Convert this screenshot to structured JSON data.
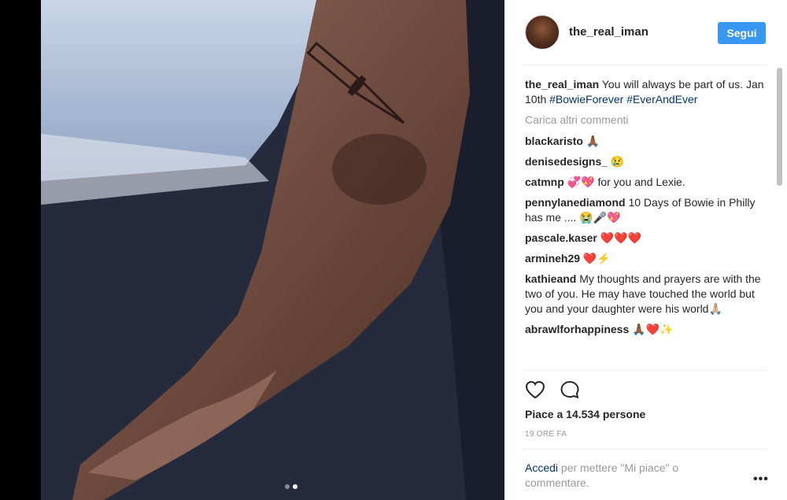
{
  "post": {
    "username": "the_real_iman",
    "follow_label": "Segui",
    "caption_text": " You will always be part of us. Jan 10th ",
    "hashtag1": "#BowieForever",
    "hashtag2": "#EverAndEver",
    "load_more": "Carica altri commenti",
    "likes": "Piace a 14.534 persone",
    "time": "19 ORE FA",
    "login_link": "Accedi",
    "login_text": " per mettere \"Mi piace\" o commentare.",
    "more_label": "•••"
  },
  "comments": [
    {
      "user": "blackaristo",
      "text": " 🙏🏾"
    },
    {
      "user": "denisedesigns_",
      "text": " 😢"
    },
    {
      "user": "catmnp",
      "text": " 💞💖 for you and Lexie."
    },
    {
      "user": "pennylanediamond",
      "text": " 10 Days of Bowie in Philly has me .... 😭🎤💖"
    },
    {
      "user": "pascale.kaser",
      "text": " ❤️❤️❤️"
    },
    {
      "user": "armineh29",
      "text": " ❤️⚡"
    },
    {
      "user": "kathieand",
      "text": " My thoughts and prayers are with the two of you. He may have touched the world but you and your daughter were his world🙏🏼"
    },
    {
      "user": "abrawlforhappiness",
      "text": " 🙏🏾❤️✨"
    }
  ],
  "icons": {
    "heart": "heart-icon",
    "comment": "comment-icon",
    "follow_color": "#3897f0"
  }
}
